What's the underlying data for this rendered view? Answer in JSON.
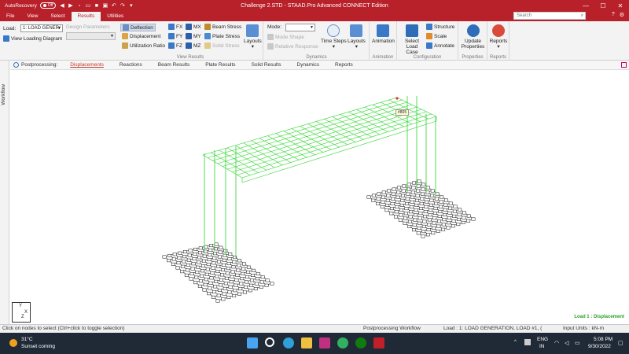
{
  "window": {
    "title": "Challenge 2.STD - STAAD.Pro Advanced CONNECT Edition",
    "autorecovery_label": "AutoRecovery",
    "autorecovery_state": "Off"
  },
  "tabs": [
    "File",
    "View",
    "Select",
    "Results",
    "Utilities"
  ],
  "active_tab": "Results",
  "search": {
    "placeholder": "Search"
  },
  "ribbon": {
    "load_label": "Load:",
    "load_value": "1: LOAD GENER/",
    "view_loading_diagram": "View Loading Diagram",
    "design_parameters_label": "Design Parameters",
    "deflection": "Deflection",
    "displacement": "Displacement",
    "utilization_ratio": "Utilization Ratio",
    "fx": "FX",
    "fy": "FY",
    "fz": "FZ",
    "mx": "MX",
    "my": "MY",
    "mz": "MZ",
    "beam_stress": "Beam Stress",
    "plate_stress": "Plate Stress",
    "solid_stress": "Solid Stress",
    "layouts": "Layouts",
    "view_results_group": "View Results",
    "mode_label": "Mode:",
    "mode_shape": "Mode Shape",
    "relative_response": "Relative Response",
    "time_steps": "Time Steps",
    "layouts2": "Layouts",
    "dynamics_group": "Dynamics",
    "animation": "Animation",
    "animation_group": "Animation",
    "select_load_case": "Select Load Case",
    "structure": "Structure",
    "scale": "Scale",
    "annotate": "Annotate",
    "configuration_group": "Configuration",
    "update_properties": "Update Properties",
    "properties_group": "Properties",
    "reports": "Reports",
    "reports_group": "Reports"
  },
  "workflow_label": "Workflow",
  "postprocessing": {
    "label": "Postprocessing:",
    "tabs": [
      "Displacements",
      "Reactions",
      "Beam Results",
      "Plate Results",
      "Solid Results",
      "Dynamics",
      "Reports"
    ],
    "active": "Displacements"
  },
  "viewport": {
    "node_tag": "#805",
    "load_caption": "Load 1 : Displacement",
    "axis_y": "Y",
    "axis_x": "X",
    "axis_z": "Z"
  },
  "status": {
    "hint": "Click on nodes to select (Ctrl+click to toggle selection)",
    "workflow": "Postprocessing Workflow",
    "load": "Load : 1: LOAD GENERATION, LOAD #1, (",
    "units": "Input Units : kN-m"
  },
  "taskbar": {
    "temp": "31°C",
    "weather": "Sunset coming",
    "lang": "ENG",
    "region": "IN",
    "time": "5:08 PM",
    "date": "9/30/2022"
  },
  "colors": {
    "brand": "#b8202a",
    "frame": "#2bd62b",
    "taskbar": "#202a36"
  }
}
